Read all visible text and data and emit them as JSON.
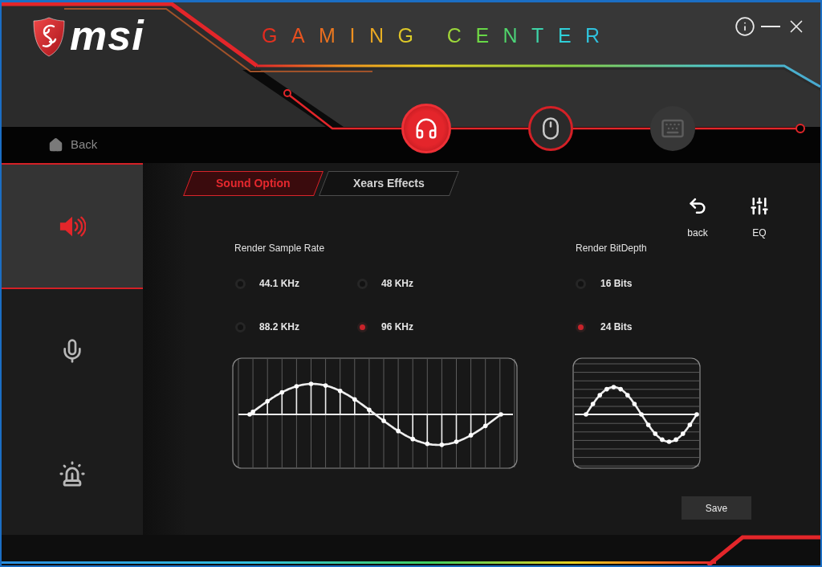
{
  "window": {
    "logo_text": "msi",
    "title": "GAMING CENTER"
  },
  "devices": [
    {
      "kind": "headset",
      "selected": true,
      "disabled": false
    },
    {
      "kind": "mouse",
      "selected": false,
      "disabled": false
    },
    {
      "kind": "keyboard",
      "selected": false,
      "disabled": true
    }
  ],
  "back_link": {
    "label": "Back"
  },
  "sidebar": {
    "items": [
      {
        "kind": "speaker",
        "selected": true
      },
      {
        "kind": "microphone",
        "selected": false
      },
      {
        "kind": "alarm",
        "selected": false
      }
    ]
  },
  "tabs": [
    {
      "label": "Sound Option",
      "selected": true
    },
    {
      "label": "Xears Effects",
      "selected": false
    }
  ],
  "actions": [
    {
      "kind": "undo",
      "label": "back"
    },
    {
      "kind": "equalizer",
      "label": "EQ"
    }
  ],
  "sample_rate": {
    "label": "Render Sample Rate",
    "options": [
      {
        "label": "44.1 KHz",
        "selected": false
      },
      {
        "label": "48 KHz",
        "selected": false
      },
      {
        "label": "88.2 KHz",
        "selected": false
      },
      {
        "label": "96 KHz",
        "selected": true
      }
    ]
  },
  "bit_depth": {
    "label": "Render BitDepth",
    "options": [
      {
        "label": "16 Bits",
        "selected": false
      },
      {
        "label": "24 Bits",
        "selected": true
      }
    ]
  },
  "save_button": {
    "label": "Save"
  }
}
